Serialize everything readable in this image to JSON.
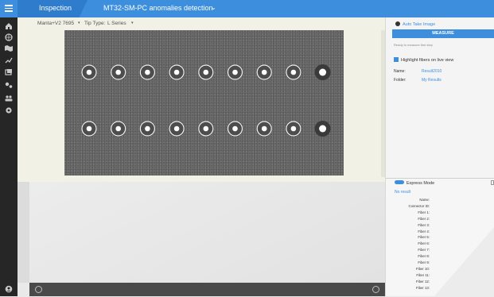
{
  "header": {
    "app_title": "Inspection",
    "document_title": "MT32-SM-PC anomalies detection",
    "document_chevron": "⌄"
  },
  "toolbar": {
    "camera": "Manta+V2 7695",
    "tip_type_label": "Tip Type:",
    "tip_type_value": "L Series"
  },
  "colors": {
    "accent": "#3d8fdd",
    "topbar": "#3d8fdd",
    "sidebar": "#262626"
  },
  "sidebar": {
    "icons": [
      "home-icon",
      "globe-icon",
      "map-icon",
      "chart-icon",
      "layers-icon",
      "tools-icon",
      "users-icon",
      "settings-icon",
      "account-icon"
    ]
  },
  "image": {
    "fiber_rows": 2,
    "fibers_per_row": 9
  },
  "right_panel": {
    "auto_take_label": "Auto Take Image",
    "measure_label": "MEASURE",
    "ready_text": "Ready to measure first step",
    "highlight_label": "Highlight fibers on live view",
    "name_label": "Name:",
    "name_value": "Result2010",
    "folder_label": "Folder:",
    "folder_value": "My Results"
  },
  "results": {
    "express_mode_label": "Express Mode",
    "no_result_label": "No result",
    "fields": [
      "Name:",
      "Connector ID:",
      "Fiber 1:",
      "Fiber 2:",
      "Fiber 3:",
      "Fiber 4:",
      "Fiber 5:",
      "Fiber 6:",
      "Fiber 7:",
      "Fiber 8:",
      "Fiber 9:",
      "Fiber 10:",
      "Fiber 11:",
      "Fiber 12:",
      "Fiber 13:"
    ]
  }
}
